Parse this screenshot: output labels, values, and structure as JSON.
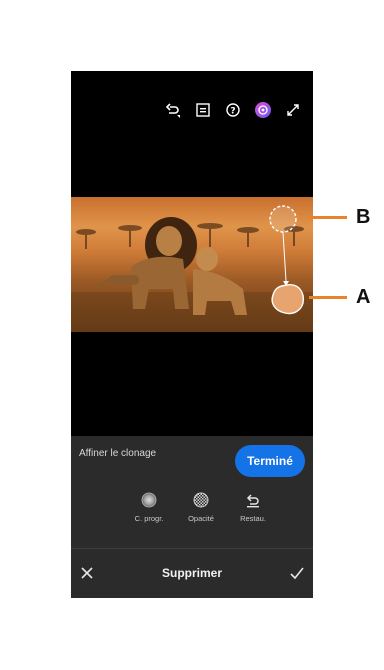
{
  "toolbar": {
    "icons": [
      "undo-icon",
      "compare-icon",
      "help-icon",
      "profile-icon",
      "fullscreen-icon"
    ]
  },
  "panel": {
    "title": "Affiner le clonage",
    "done_label": "Terminé",
    "tools": [
      {
        "label": "C. progr.",
        "icon": "feather-icon"
      },
      {
        "label": "Opacité",
        "icon": "opacity-icon"
      },
      {
        "label": "Restau.",
        "icon": "restore-icon"
      }
    ]
  },
  "bottom_bar": {
    "title": "Supprimer"
  },
  "callouts": {
    "source": "B",
    "target": "A"
  },
  "colors": {
    "accent": "#1473e6",
    "callout": "#e8822b",
    "panel_bg": "#2b2b2b"
  }
}
